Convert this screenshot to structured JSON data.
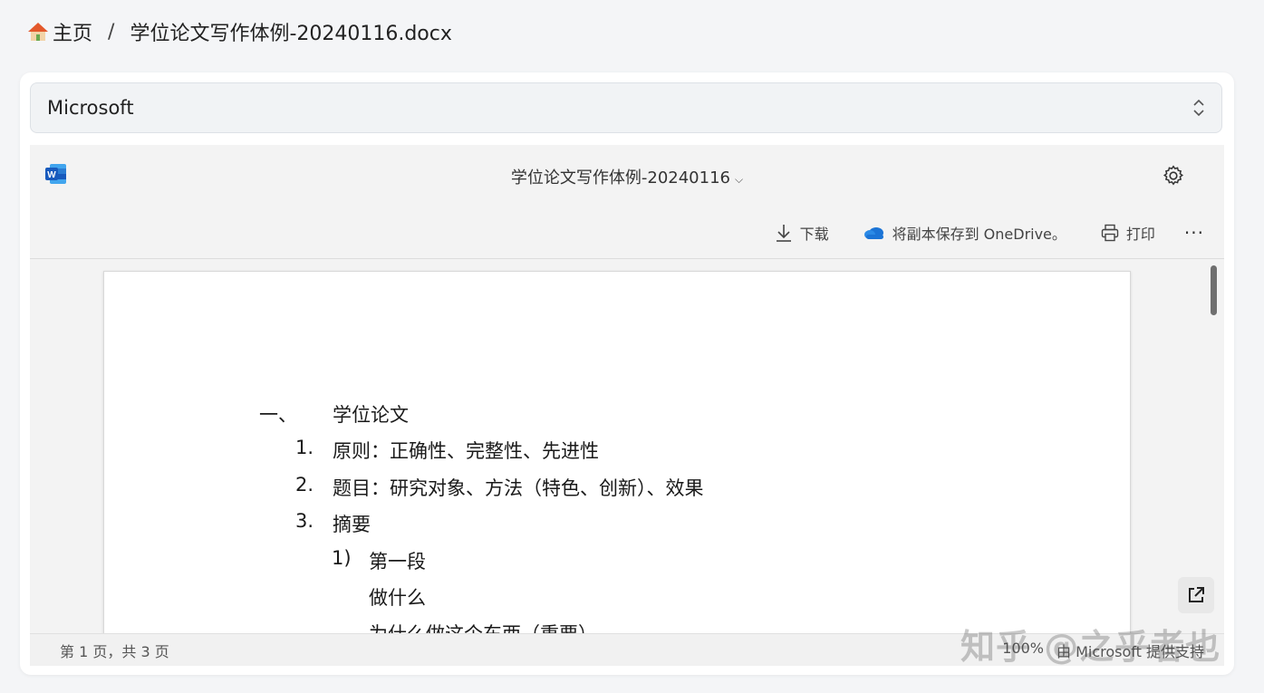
{
  "breadcrumb": {
    "home_label": "主页",
    "separator": "/",
    "current_file": "学位论文写作体例-20240116.docx"
  },
  "selector": {
    "value": "Microsoft"
  },
  "viewer": {
    "doc_title": "学位论文写作体例-20240116",
    "toolbar": {
      "download": "下载",
      "save_onedrive": "将副本保存到 OneDrive。",
      "print": "打印",
      "more": "···"
    },
    "status": {
      "page_info": "第 1 页，共 3 页",
      "zoom": "100%",
      "provider": "由 Microsoft 提供支持"
    }
  },
  "document": {
    "lines": [
      {
        "num": "一、",
        "text": "学位论文"
      },
      {
        "num": "1.",
        "text": "原则：正确性、完整性、先进性"
      },
      {
        "num": "2.",
        "text": "题目：研究对象、方法（特色、创新）、效果"
      },
      {
        "num": "3.",
        "text": "摘要"
      },
      {
        "num": "1)",
        "text": "第一段"
      },
      {
        "num": "",
        "text": "做什么"
      },
      {
        "num": "",
        "text": "为什么做这个东西（重要）"
      }
    ]
  },
  "watermark": "知乎 @之乎者也",
  "colors": {
    "word_blue": "#185abd",
    "onedrive_blue": "#1b74d6",
    "home_roof": "#e3582b"
  }
}
